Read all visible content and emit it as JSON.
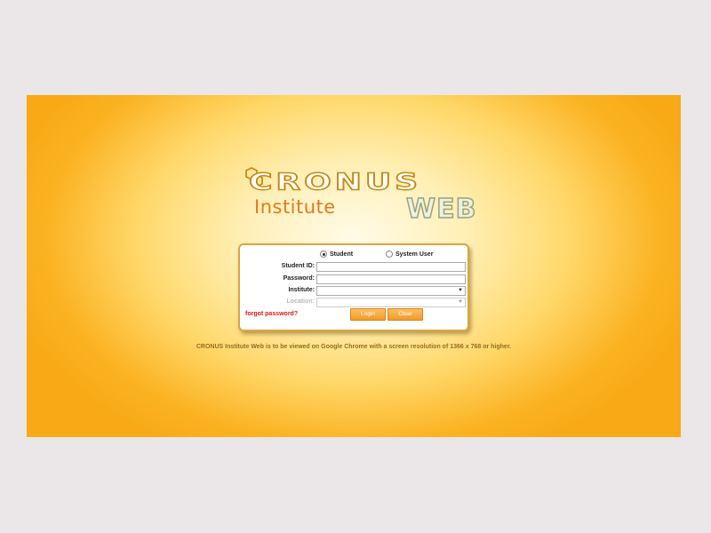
{
  "brand": {
    "logo_word": "CRONUS",
    "sub_word": "Institute",
    "web_word": "WEB"
  },
  "login": {
    "user_types": [
      {
        "label": "Student",
        "selected": true
      },
      {
        "label": "System User",
        "selected": false
      }
    ],
    "fields": {
      "student_id_label": "Student ID:",
      "student_id_value": "",
      "password_label": "Password:",
      "password_value": "",
      "institute_label": "Institute:",
      "institute_value": "",
      "location_label": "Location:",
      "location_value": ""
    },
    "forgot_label": "forgot password?",
    "login_label": "Login",
    "clear_label": "Clear"
  },
  "notice": "CRONUS Institute Web is to be viewed on Google Chrome with a screen resolution of 1366 x 768 or higher.",
  "colors": {
    "accent": "#f19a27",
    "background_edge": "#f8a915",
    "forgot_link": "#d81b0f"
  }
}
